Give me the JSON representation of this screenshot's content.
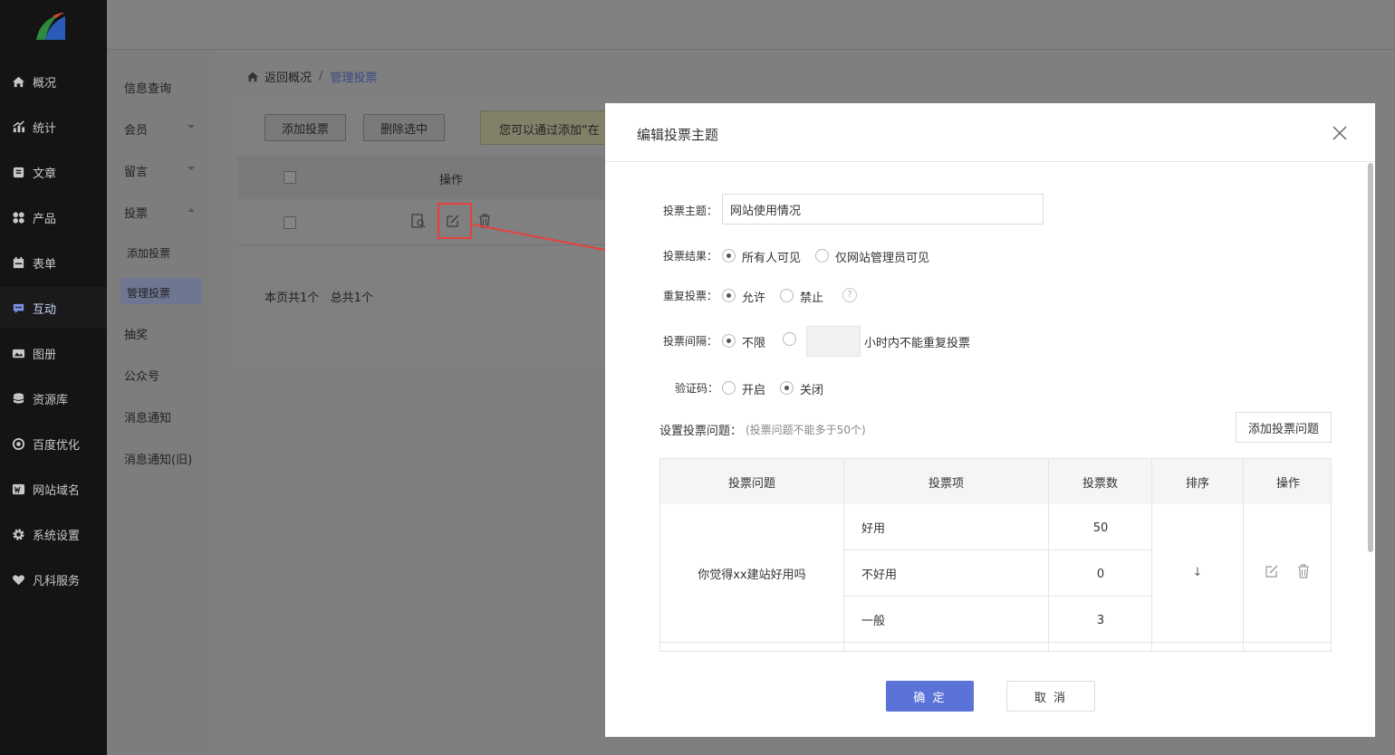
{
  "sidebar": {
    "items": [
      {
        "label": "概况",
        "icon": "home-icon"
      },
      {
        "label": "统计",
        "icon": "stats-icon"
      },
      {
        "label": "文章",
        "icon": "article-icon"
      },
      {
        "label": "产品",
        "icon": "product-icon"
      },
      {
        "label": "表单",
        "icon": "form-icon"
      },
      {
        "label": "互动",
        "icon": "chat-icon"
      },
      {
        "label": "图册",
        "icon": "gallery-icon"
      },
      {
        "label": "资源库",
        "icon": "database-icon"
      },
      {
        "label": "百度优化",
        "icon": "seo-icon"
      },
      {
        "label": "网站域名",
        "icon": "domain-icon"
      },
      {
        "label": "系统设置",
        "icon": "gear-icon"
      },
      {
        "label": "凡科服务",
        "icon": "heart-icon"
      }
    ]
  },
  "submenu": {
    "items": [
      "信息查询",
      "会员",
      "留言",
      "投票",
      "添加投票",
      "管理投票",
      "抽奖",
      "公众号",
      "消息通知",
      "消息通知(旧)"
    ]
  },
  "breadcrumb": {
    "back": "返回概况",
    "sep": "/",
    "current": "管理投票"
  },
  "toolbar": {
    "add_label": "添加投票",
    "delete_label": "删除选中",
    "notice": "您可以通过添加“在"
  },
  "list": {
    "ops_header": "操作",
    "pager": "本页共1个   总共1个"
  },
  "modal": {
    "title": "编辑投票主题",
    "topic_label": "投票主题：",
    "topic_value": "网站使用情况",
    "result_label": "投票结果：",
    "result_opt1": "所有人可见",
    "result_opt2": "仅网站管理员可见",
    "repeat_label": "重复投票：",
    "repeat_opt1": "允许",
    "repeat_opt2": "禁止",
    "help": "?",
    "interval_label": "投票间隔：",
    "interval_opt1": "不限",
    "interval_suffix": "小时内不能重复投票",
    "captcha_label": "验证码：",
    "captcha_opt1": "开启",
    "captcha_opt2": "关闭",
    "questions_label": "设置投票问题：",
    "questions_note": "(投票问题不能多于50个)",
    "add_question": "添加投票问题",
    "table": {
      "headers": [
        "投票问题",
        "投票项",
        "投票数",
        "排序",
        "操作"
      ],
      "question": "你觉得xx建站好用吗",
      "rows": [
        {
          "option": "好用",
          "count": "50"
        },
        {
          "option": "不好用",
          "count": "0"
        },
        {
          "option": "一般",
          "count": "3"
        }
      ],
      "sort_symbol": "↓"
    },
    "ok": "确 定",
    "cancel": "取 消"
  },
  "colors": {
    "primary": "#5b73d8",
    "highlight": "#e8403a",
    "sidebar": "#141414"
  }
}
